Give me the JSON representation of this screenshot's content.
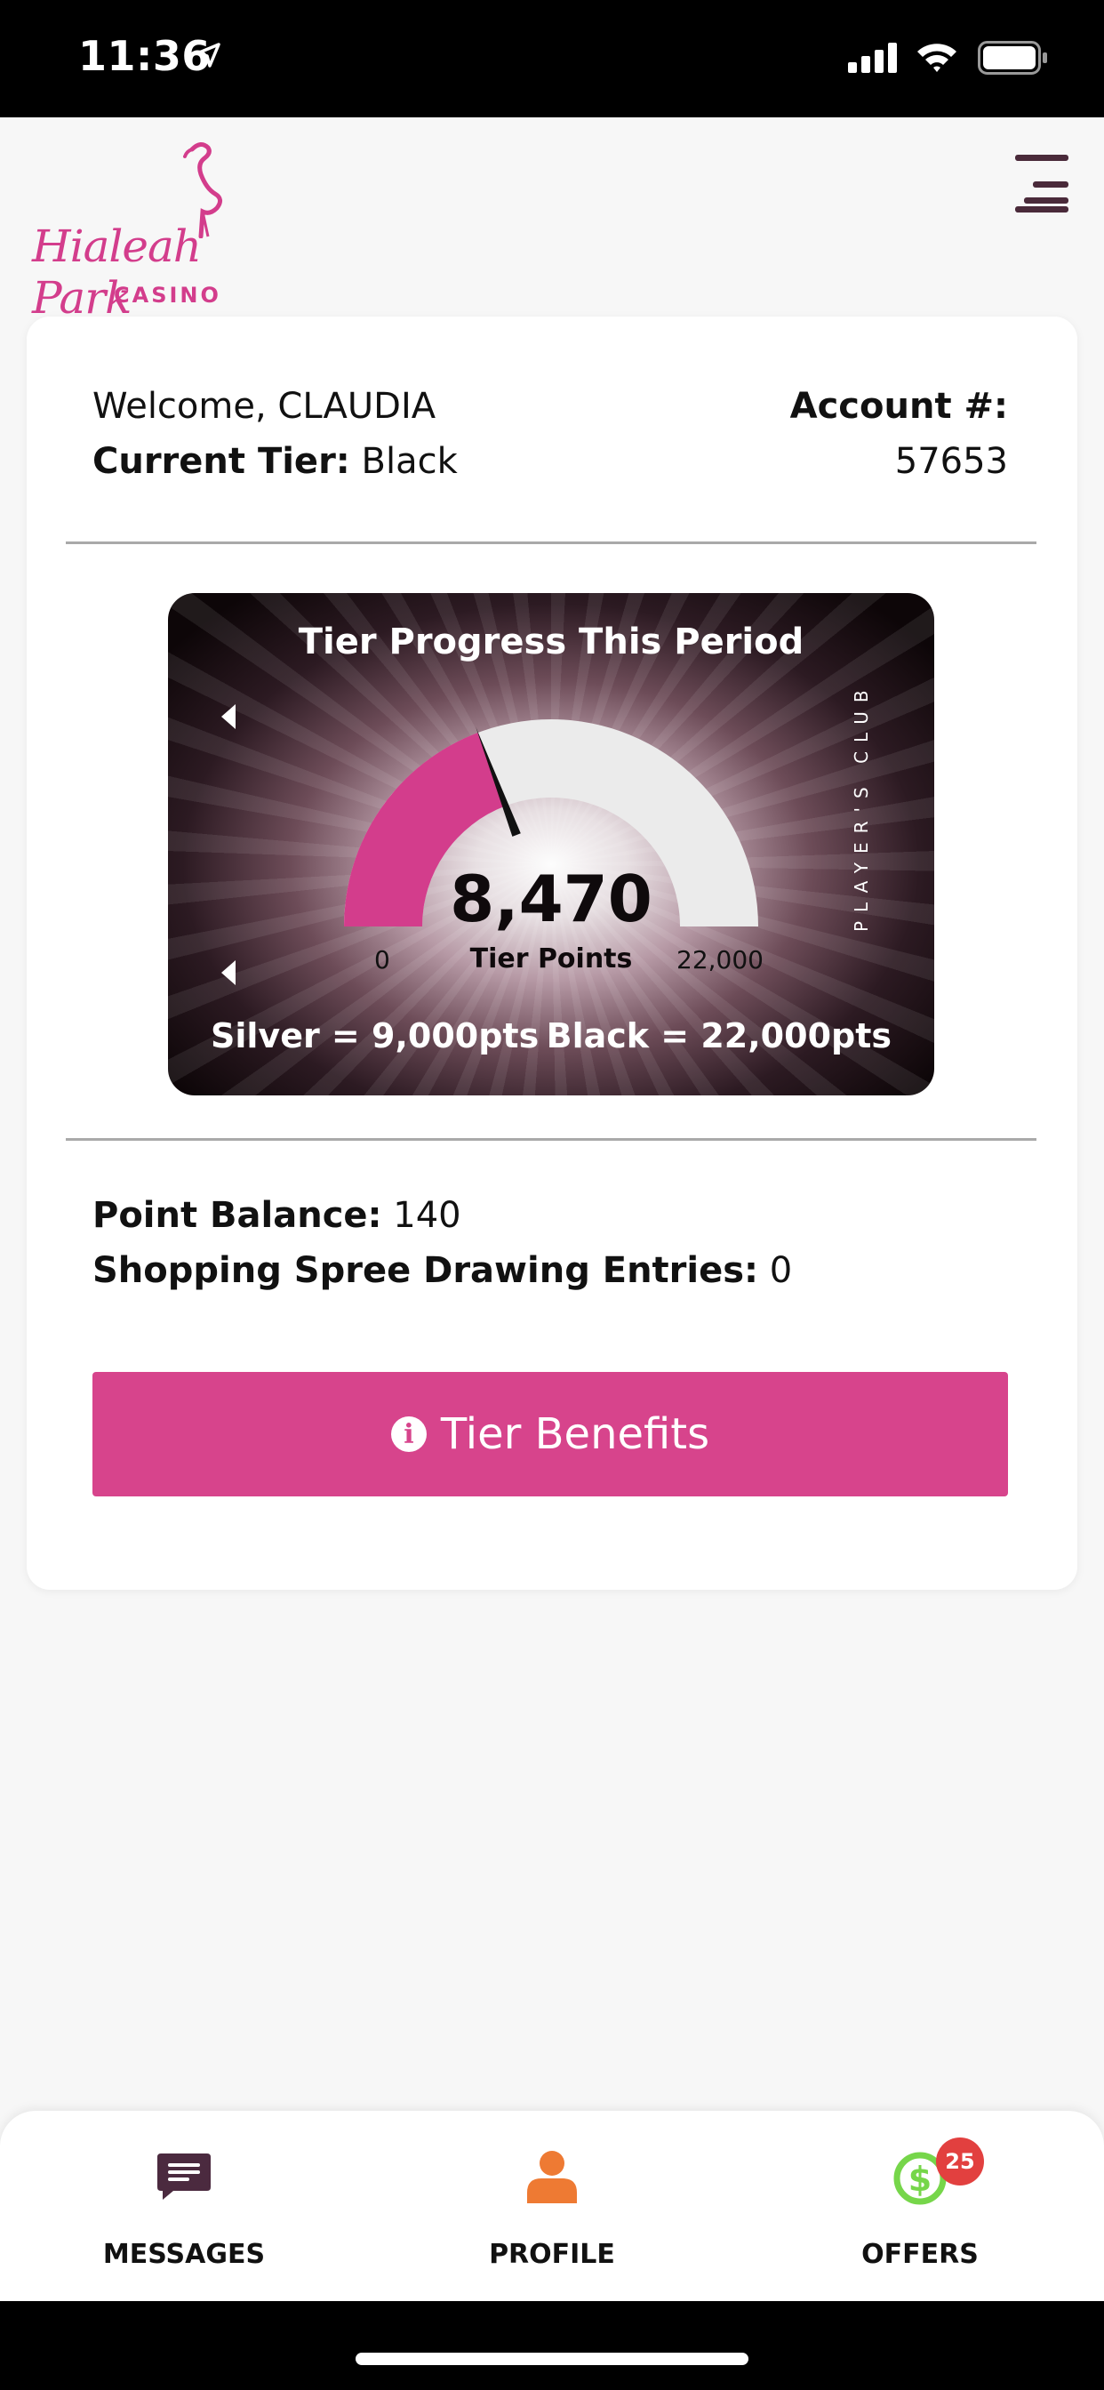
{
  "status_bar": {
    "time": "11:36"
  },
  "header": {
    "logo_text": "Hialeah Park",
    "logo_sub": "CASINO",
    "brand_color": "#d33d8c"
  },
  "account": {
    "welcome": "Welcome, CLAUDIA",
    "tier_label": "Current Tier:",
    "tier_value": " Black",
    "account_label": "Account #:",
    "account_number": "57653"
  },
  "gauge": {
    "title": "Tier Progress This Period",
    "value": "8,470",
    "unit": "Tier Points",
    "min": "0",
    "max": "22,000",
    "progress_fraction": 0.385,
    "side_text": "PLAYER'S CLUB",
    "silver_label": "Silver = 9,000pts",
    "black_label": "Black = 22,000pts",
    "fill_color": "#d33d8c"
  },
  "balances": {
    "point_label": "Point Balance:",
    "point_value": " 140",
    "entries_label": "Shopping Spree Drawing Entries:",
    "entries_value": " 0"
  },
  "tier_button": {
    "label": "Tier Benefits",
    "icon": "info-icon",
    "color": "#d7448c"
  },
  "bottom_nav": {
    "items": [
      {
        "label": "MESSAGES",
        "icon": "message-icon"
      },
      {
        "label": "PROFILE",
        "icon": "profile-icon"
      },
      {
        "label": "OFFERS",
        "icon": "dollar-icon",
        "badge": "25"
      }
    ]
  }
}
